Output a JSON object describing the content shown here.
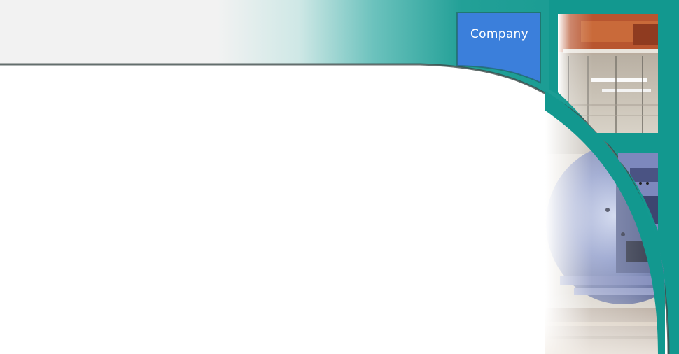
{
  "nav": {
    "company_label": "Company"
  },
  "photos": {
    "top_photo_icon": "industrial-ceiling-photo",
    "bottom_photo_icon": "boiler-machinery-photo"
  },
  "colors": {
    "header_gray": "#f2f2f2",
    "teal": "#12988f",
    "teal_light": "#66c1bc",
    "tab_blue": "#3b7fdb",
    "border_dark": "#1f5e5a",
    "boiler_blue": "#6f80b4"
  }
}
